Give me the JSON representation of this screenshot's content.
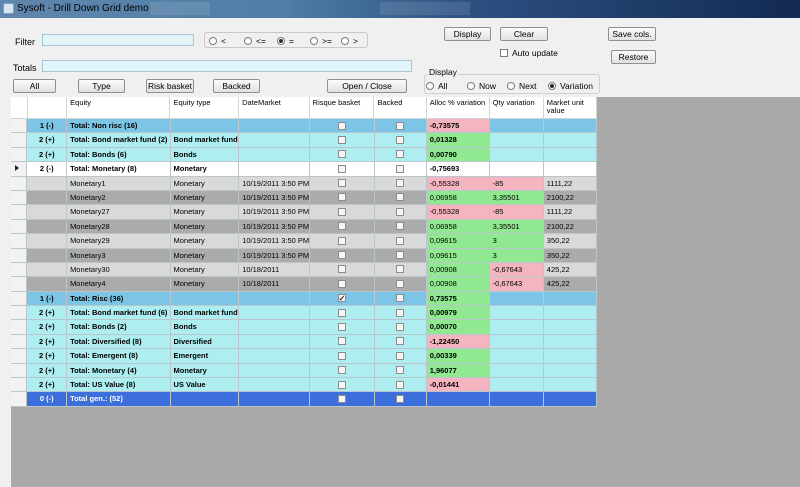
{
  "window": {
    "title": "Sysoft - Drill Down Grid demo"
  },
  "filter": {
    "label": "Filter",
    "value": ""
  },
  "totals": {
    "label": "Totals",
    "value": ""
  },
  "comparators": [
    {
      "label": "<",
      "checked": false
    },
    {
      "label": "<=",
      "checked": false
    },
    {
      "label": "=",
      "checked": true
    },
    {
      "label": ">=",
      "checked": false
    },
    {
      "label": ">",
      "checked": false
    }
  ],
  "buttons": {
    "display": "Display",
    "clear": "Clear",
    "save_cols": "Save cols.",
    "restore": "Restore",
    "all": "All",
    "type": "Type",
    "risk_basket": "Risk basket",
    "backed": "Backed",
    "open_close": "Open / Close"
  },
  "auto_update": {
    "label": "Auto update",
    "checked": false
  },
  "display_group": {
    "legend": "Display",
    "options": [
      {
        "label": "All",
        "checked": false
      },
      {
        "label": "Now",
        "checked": false
      },
      {
        "label": "Next",
        "checked": false
      },
      {
        "label": "Variation",
        "checked": true
      }
    ]
  },
  "grid": {
    "columns": [
      "Equity",
      "Equity type",
      "DateMarket",
      "Risque basket",
      "Backed",
      "Alloc % variation",
      "Qty variation",
      "Market unit value"
    ],
    "rows": [
      {
        "style": "l1",
        "level": "1 (-)",
        "equity": "Total: Non risc (16)",
        "type": "",
        "date": "",
        "risque": false,
        "backed": false,
        "alloc": "-0,73575",
        "alloc_sign": "neg",
        "qty": "",
        "qty_sign": "",
        "market": ""
      },
      {
        "style": "l2",
        "level": "2 (+)",
        "equity": "Total: Bond market fund (2)",
        "type": "Bond market fund",
        "date": "",
        "risque": false,
        "backed": false,
        "alloc": "0,01328",
        "alloc_sign": "pos",
        "qty": "",
        "qty_sign": "",
        "market": ""
      },
      {
        "style": "l2",
        "level": "2 (+)",
        "equity": "Total: Bonds (6)",
        "type": "Bonds",
        "date": "",
        "risque": false,
        "backed": false,
        "alloc": "0,00790",
        "alloc_sign": "pos",
        "qty": "",
        "qty_sign": "",
        "market": ""
      },
      {
        "style": "lcur",
        "level": "2 (-)",
        "equity": "Total: Monetary (8)",
        "type": "Monetary",
        "date": "",
        "risque": false,
        "backed": false,
        "alloc": "-0,75693",
        "alloc_sign": "",
        "qty": "",
        "qty_sign": "",
        "market": "",
        "current": true
      },
      {
        "style": "d0",
        "level": "",
        "equity": "Monetary1",
        "type": "Monetary",
        "date": "10/19/2011 3:50 PM",
        "risque": false,
        "backed": false,
        "alloc": "-0,55328",
        "alloc_sign": "neg",
        "qty": "-85",
        "qty_sign": "neg",
        "market": "1111,22"
      },
      {
        "style": "d1",
        "level": "",
        "equity": "Monetary2",
        "type": "Monetary",
        "date": "10/19/2011 3:50 PM",
        "risque": false,
        "backed": false,
        "alloc": "0,06958",
        "alloc_sign": "pos",
        "qty": "3,35501",
        "qty_sign": "pos",
        "market": "2100,22"
      },
      {
        "style": "d0",
        "level": "",
        "equity": "Monetary27",
        "type": "Monetary",
        "date": "10/19/2011 3:50 PM",
        "risque": false,
        "backed": false,
        "alloc": "-0,55328",
        "alloc_sign": "neg",
        "qty": "-85",
        "qty_sign": "neg",
        "market": "1111,22"
      },
      {
        "style": "d1",
        "level": "",
        "equity": "Monetary28",
        "type": "Monetary",
        "date": "10/19/2011 3:50 PM",
        "risque": false,
        "backed": false,
        "alloc": "0,06958",
        "alloc_sign": "pos",
        "qty": "3,35501",
        "qty_sign": "pos",
        "market": "2100,22"
      },
      {
        "style": "d0",
        "level": "",
        "equity": "Monetary29",
        "type": "Monetary",
        "date": "10/19/2011 3:50 PM",
        "risque": false,
        "backed": false,
        "alloc": "0,09615",
        "alloc_sign": "pos",
        "qty": "3",
        "qty_sign": "pos",
        "market": "350,22"
      },
      {
        "style": "d1",
        "level": "",
        "equity": "Monetary3",
        "type": "Monetary",
        "date": "10/19/2011 3:50 PM",
        "risque": false,
        "backed": false,
        "alloc": "0,09615",
        "alloc_sign": "pos",
        "qty": "3",
        "qty_sign": "pos",
        "market": "350,22"
      },
      {
        "style": "d0",
        "level": "",
        "equity": "Monetary30",
        "type": "Monetary",
        "date": "10/18/2011",
        "risque": false,
        "backed": false,
        "alloc": "0,00908",
        "alloc_sign": "pos",
        "qty": "-0,67643",
        "qty_sign": "neg",
        "market": "425,22"
      },
      {
        "style": "d1",
        "level": "",
        "equity": "Monetary4",
        "type": "Monetary",
        "date": "10/18/2011",
        "risque": false,
        "backed": false,
        "alloc": "0,00908",
        "alloc_sign": "pos",
        "qty": "-0,67643",
        "qty_sign": "neg",
        "market": "425,22"
      },
      {
        "style": "l1",
        "level": "1 (-)",
        "equity": "Total: Risc (36)",
        "type": "",
        "date": "",
        "risque": true,
        "backed": false,
        "alloc": "0,73575",
        "alloc_sign": "pos",
        "qty": "",
        "qty_sign": "",
        "market": ""
      },
      {
        "style": "l2",
        "level": "2 (+)",
        "equity": "Total: Bond market fund (6)",
        "type": "Bond market fund",
        "date": "",
        "risque": false,
        "backed": false,
        "alloc": "0,00979",
        "alloc_sign": "pos",
        "qty": "",
        "qty_sign": "",
        "market": ""
      },
      {
        "style": "l2",
        "level": "2 (+)",
        "equity": "Total: Bonds (2)",
        "type": "Bonds",
        "date": "",
        "risque": false,
        "backed": false,
        "alloc": "0,00070",
        "alloc_sign": "pos",
        "qty": "",
        "qty_sign": "",
        "market": ""
      },
      {
        "style": "l2",
        "level": "2 (+)",
        "equity": "Total: Diversified (8)",
        "type": "Diversified",
        "date": "",
        "risque": false,
        "backed": false,
        "alloc": "-1,22450",
        "alloc_sign": "neg",
        "qty": "",
        "qty_sign": "",
        "market": ""
      },
      {
        "style": "l2",
        "level": "2 (+)",
        "equity": "Total: Emergent (8)",
        "type": "Emergent",
        "date": "",
        "risque": false,
        "backed": false,
        "alloc": "0,00339",
        "alloc_sign": "pos",
        "qty": "",
        "qty_sign": "",
        "market": ""
      },
      {
        "style": "l2",
        "level": "2 (+)",
        "equity": "Total: Monetary (4)",
        "type": "Monetary",
        "date": "",
        "risque": false,
        "backed": false,
        "alloc": "1,96077",
        "alloc_sign": "pos",
        "qty": "",
        "qty_sign": "",
        "market": ""
      },
      {
        "style": "l2",
        "level": "2 (+)",
        "equity": "Total: US Value (8)",
        "type": "US Value",
        "date": "",
        "risque": false,
        "backed": false,
        "alloc": "-0,01441",
        "alloc_sign": "neg",
        "qty": "",
        "qty_sign": "",
        "market": ""
      },
      {
        "style": "l0",
        "level": "0 (-)",
        "equity": "Total gen.: (52)",
        "type": "",
        "date": "",
        "risque": false,
        "backed": false,
        "alloc": "",
        "alloc_sign": "",
        "qty": "",
        "qty_sign": "",
        "market": ""
      }
    ]
  }
}
